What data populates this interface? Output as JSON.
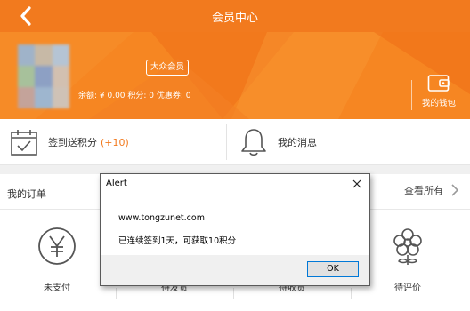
{
  "header": {
    "title": "会员中心"
  },
  "profile": {
    "badge": "大众会员",
    "balance_text": "余额: ¥ 0.00  积分: 0  优惠券: 0",
    "wallet_label": "我的钱包"
  },
  "quick": {
    "checkin_label": "签到送积分",
    "checkin_bonus": "(+10)",
    "messages_label": "我的消息"
  },
  "orders": {
    "title": "我的订单",
    "view_all": "查看所有",
    "items": [
      {
        "label": "未支付",
        "icon": "yen-icon"
      },
      {
        "label": "待发货",
        "icon": "box-icon"
      },
      {
        "label": "待收货",
        "icon": "truck-icon"
      },
      {
        "label": "待评价",
        "icon": "flower-icon"
      }
    ]
  },
  "alert": {
    "title": "Alert",
    "host": "www.tongzunet.com",
    "message": "已连续签到1天，可获取10积分",
    "ok_label": "OK"
  },
  "colors": {
    "brand": "#f27a1e",
    "hero": "#f68622"
  }
}
